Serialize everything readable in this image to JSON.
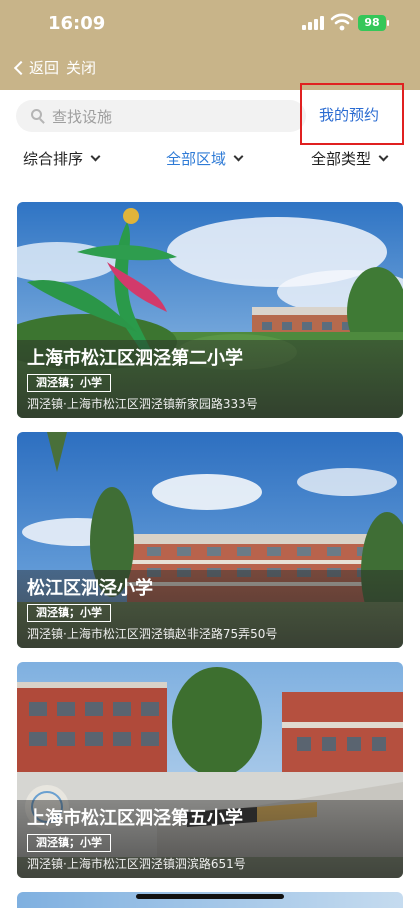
{
  "status": {
    "time": "16:09",
    "battery": "98"
  },
  "nav": {
    "back": "返回",
    "close": "关闭"
  },
  "search": {
    "placeholder": "查找设施",
    "my_reservations": "我的预约"
  },
  "filters": [
    {
      "label": "综合排序",
      "active": false
    },
    {
      "label": "全部区域",
      "active": true
    },
    {
      "label": "全部类型",
      "active": false
    }
  ],
  "cards": [
    {
      "title": "上海市松江区泗泾第二小学",
      "tag": "泗泾镇；小学",
      "address": "泗泾镇·上海市松江区泗泾镇新家园路333号"
    },
    {
      "title": "松江区泗泾小学",
      "tag": "泗泾镇；小学",
      "address": "泗泾镇·上海市松江区泗泾镇赵非泾路75弄50号"
    },
    {
      "title": "上海市松江区泗泾第五小学",
      "tag": "泗泾镇；小学",
      "address": "泗泾镇·上海市松江区泗泾镇泗滨路651号"
    }
  ],
  "colors": {
    "header": "#c8b489",
    "accent": "#2a6bd1",
    "highlight_border": "#e02020"
  }
}
